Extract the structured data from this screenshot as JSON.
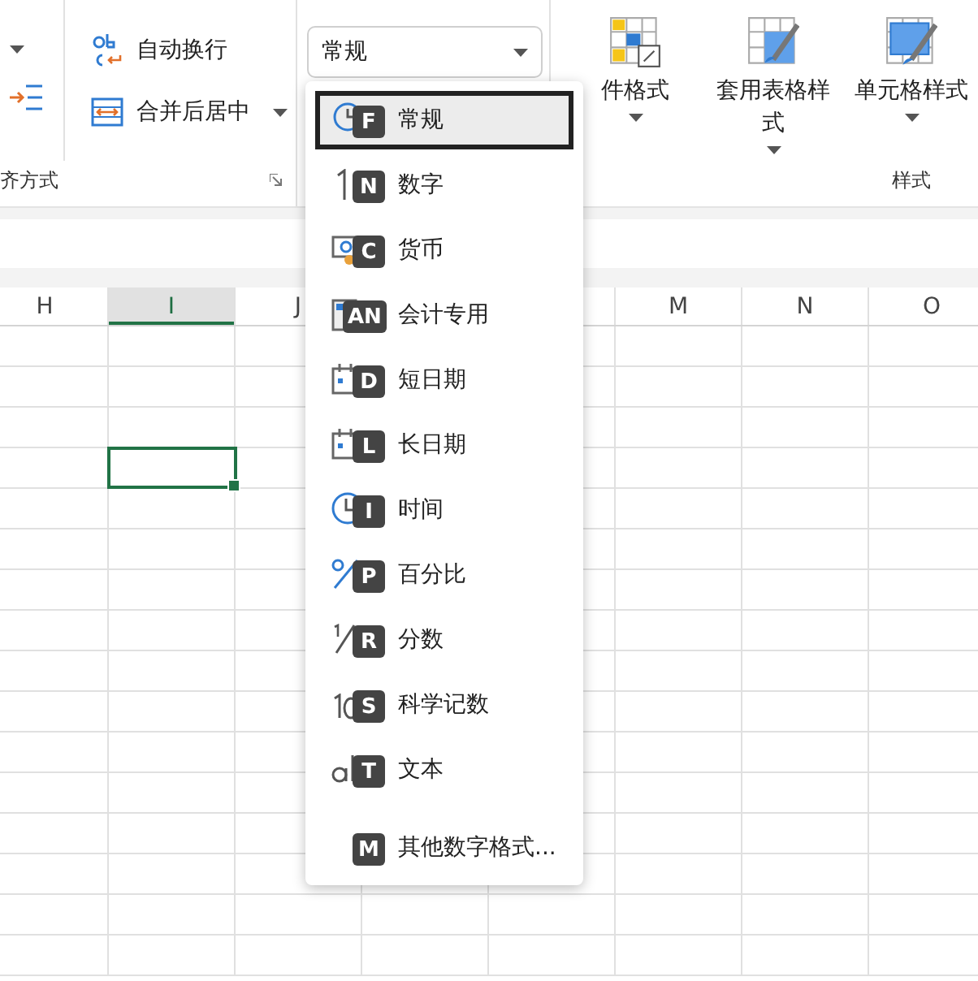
{
  "ribbon": {
    "alignment": {
      "wrap_text": "自动换行",
      "merge_center": "合并后居中",
      "group_label": "齐方式"
    },
    "number": {
      "format_value": "常规"
    },
    "styles": {
      "buttons": [
        {
          "kind": "conditional",
          "label": "件格式"
        },
        {
          "kind": "table",
          "label": "套用表格样式"
        },
        {
          "kind": "cell",
          "label": "单元格样式"
        }
      ],
      "group_label": "样式"
    }
  },
  "format_menu": {
    "items": [
      {
        "kind": "general",
        "key": "F",
        "label": "常规",
        "selected": true
      },
      {
        "kind": "number",
        "key": "N",
        "label": "数字",
        "selected": false
      },
      {
        "kind": "currency",
        "key": "C",
        "label": "货币",
        "selected": false
      },
      {
        "kind": "accounting",
        "key": "AN",
        "label": "会计专用",
        "selected": false
      },
      {
        "kind": "date",
        "key": "D",
        "label": "短日期",
        "selected": false
      },
      {
        "kind": "date",
        "key": "L",
        "label": "长日期",
        "selected": false
      },
      {
        "kind": "time",
        "key": "I",
        "label": "时间",
        "selected": false
      },
      {
        "kind": "percent",
        "key": "P",
        "label": "百分比",
        "selected": false
      },
      {
        "kind": "fraction",
        "key": "R",
        "label": "分数",
        "selected": false
      },
      {
        "kind": "scientific",
        "key": "S",
        "label": "科学记数",
        "selected": false
      },
      {
        "kind": "text",
        "key": "T",
        "label": "文本",
        "selected": false
      }
    ],
    "more": {
      "key": "M",
      "label": "其他数字格式..."
    }
  },
  "sheet": {
    "columns": [
      {
        "label": "H",
        "selected": false
      },
      {
        "label": "I",
        "selected": true
      },
      {
        "label": "J",
        "selected": false
      },
      {
        "label": "M",
        "selected": false,
        "covered_before": true
      },
      {
        "label": "N",
        "selected": false
      },
      {
        "label": "O",
        "selected": false
      }
    ],
    "rows": [
      {
        "selected": false
      },
      {
        "selected": false
      },
      {
        "selected": false
      },
      {
        "selected": true
      },
      {
        "selected": false
      },
      {
        "selected": false
      },
      {
        "selected": false
      },
      {
        "selected": false
      },
      {
        "selected": false
      },
      {
        "selected": false
      },
      {
        "selected": false
      },
      {
        "selected": false
      },
      {
        "selected": false
      },
      {
        "selected": false
      },
      {
        "selected": false
      },
      {
        "selected": false
      }
    ]
  }
}
